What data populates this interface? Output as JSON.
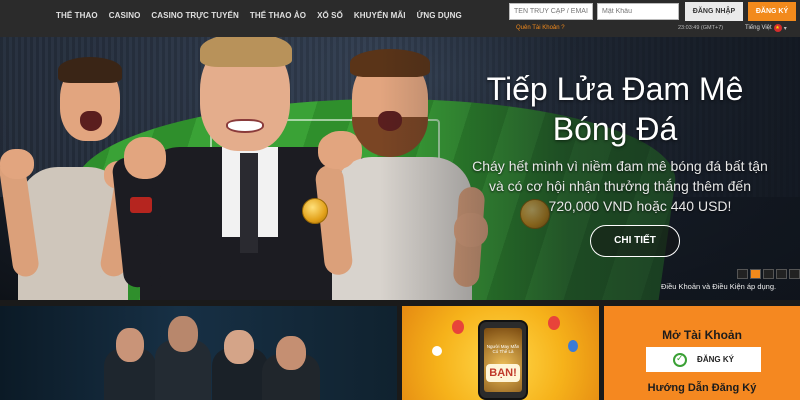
{
  "nav": {
    "items": [
      "THỂ THAO",
      "CASINO",
      "CASINO TRỰC TUYẾN",
      "THỂ THAO ẢO",
      "XỔ SỐ",
      "KHUYẾN MÃI",
      "ỨNG DỤNG"
    ]
  },
  "login": {
    "username_placeholder": "TÊN TRUY CẬP / EMAIL",
    "password_placeholder": "Mật Khẩu",
    "login_label": "ĐĂNG NHẬP",
    "register_label": "ĐĂNG KÝ",
    "forgot_label": "Quên Tài Khoản ?",
    "time": "23:03:49 (GMT+7)",
    "language": "Tiếng Việt"
  },
  "hero": {
    "title_line1": "Tiếp Lửa Đam Mê",
    "title_line2": "Bóng Đá",
    "subtitle_line1": "Cháy hết mình vì niềm đam mê bóng đá bất tận",
    "subtitle_line2": "và có cơ hội nhận thưởng thắng thêm đến",
    "subtitle_line3": "720,000 VND hoặc 440 USD!",
    "cta_label": "CHI TIẾT",
    "terms_label": "Điều Khoản và Điều Kiện áp dụng.",
    "slide_count": 5,
    "active_slide": 1
  },
  "promo_phone": {
    "screen_text": "Người May Mắn Có Thể Là",
    "banner_text": "BẠN!"
  },
  "account_tile": {
    "title": "Mở Tài Khoản",
    "register_label": "ĐĂNG KÝ",
    "guide_title": "Hướng Dẫn Đăng Ký"
  },
  "colors": {
    "accent": "#f28a1c",
    "topbar": "#2b2b2b",
    "account_tile": "#f58820"
  }
}
